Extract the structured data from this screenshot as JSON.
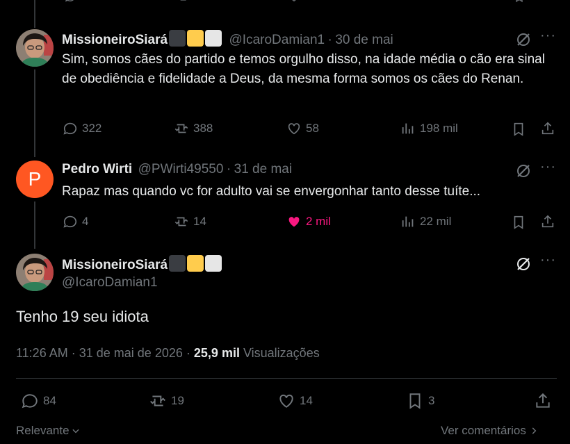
{
  "reply1": {
    "name": "MissioneiroSiará",
    "handle": "@IcaroDamian1",
    "sep": "·",
    "date": "30 de mai",
    "text": "Sim, somos cães do partido e temos orgulho disso, na idade média o cão era sinal de obediência e fidelidade a Deus, da mesma forma somos os cães do Renan.",
    "replies": "322",
    "reposts": "388",
    "likes": "58",
    "views": "198 mil"
  },
  "reply2": {
    "avatar_letter": "P",
    "name": "Pedro Wirti",
    "handle": "@PWirti49550",
    "sep": "·",
    "date": "31 de mai",
    "text": "Rapaz mas quando vc for adulto vai se envergonhar tanto desse tuíte...",
    "replies": "4",
    "reposts": "14",
    "likes": "2 mil",
    "views": "22 mil"
  },
  "main": {
    "name": "MissioneiroSiará",
    "handle": "@IcaroDamian1",
    "text": "Tenho 19 seu idiota",
    "time": "11:26 AM",
    "sep": "·",
    "date": "31 de mai de 2026",
    "views_count": "25,9 mil",
    "views_label": "Visualizações",
    "replies": "84",
    "reposts": "19",
    "likes": "14",
    "bookmarks": "3"
  },
  "footer": {
    "sort_label": "Relevante",
    "view_comments": "Ver comentários"
  },
  "colors": {
    "background": "#000000",
    "text": "#e7e9ea",
    "muted": "#71767b",
    "like_active": "#f91880",
    "avatar_orange": "#ff5722",
    "badge_dark": "#3a3d42",
    "badge_yellow": "#ffcc4d",
    "badge_white": "#e6e6e6"
  }
}
